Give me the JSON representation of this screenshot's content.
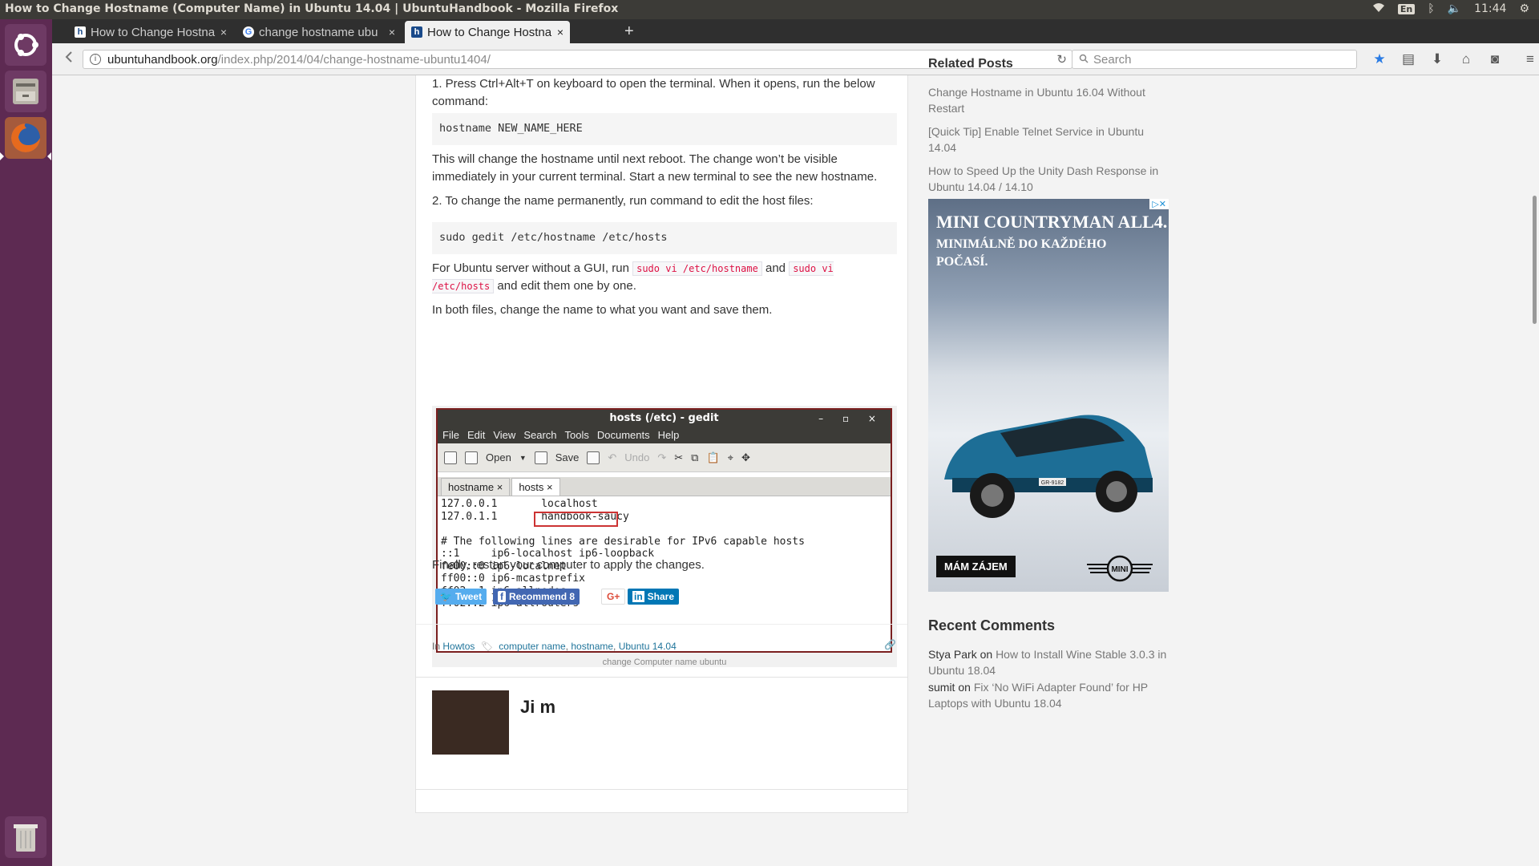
{
  "window": {
    "title": "How to Change Hostname (Computer Name) in Ubuntu 14.04 | UbuntuHandbook - Mozilla Firefox"
  },
  "panel": {
    "keyboard": "En",
    "clock": "11:44"
  },
  "tabs": [
    {
      "label": "How to Change Hostna",
      "favicon": "ubuntuhandbook-h"
    },
    {
      "label": "change hostname ubu",
      "favicon": "google-g"
    },
    {
      "label": "How to Change Hostna",
      "favicon": "ubuntuhandbook-h"
    }
  ],
  "navbar": {
    "url_host": "ubuntuhandbook.org",
    "url_path": "/index.php/2014/04/change-hostname-ubuntu1404/",
    "search_placeholder": "Search"
  },
  "article": {
    "p1": "1. Press Ctrl+Alt+T on keyboard to open the terminal. When it opens, run the below command:",
    "code1": "hostname NEW_NAME_HERE",
    "p2": "This will change the hostname until next reboot. The change won’t be visible immediately in your current terminal. Start a new terminal to see the new hostname.",
    "p3": "2. To change the name permanently, run command to edit the host files:",
    "code2": "sudo gedit /etc/hostname /etc/hosts",
    "p4_a": "For Ubuntu server without a GUI, run ",
    "p4_code1": "sudo vi /etc/hostname",
    "p4_b": " and ",
    "p4_code2": "sudo vi /etc/hosts",
    "p4_c": " and edit them one by one.",
    "p5": "In both files, change the name to what you want and save them.",
    "p6": "Finally, restart your computer to apply the changes."
  },
  "gedit": {
    "title": "hosts (/etc) - gedit",
    "menu": [
      "File",
      "Edit",
      "View",
      "Search",
      "Tools",
      "Documents",
      "Help"
    ],
    "toolbar": {
      "open": "Open",
      "save": "Save",
      "undo": "Undo"
    },
    "tabs": [
      "hostname",
      "hosts"
    ],
    "lines": [
      "127.0.0.1       localhost",
      "127.0.1.1       handbook-saucy",
      "",
      "# The following lines are desirable for IPv6 capable hosts",
      "::1     ip6-localhost ip6-loopback",
      "fe00::0 ip6-localnet",
      "ff00::0 ip6-mcastprefix",
      "ff02::1 ip6-allnodes",
      "ff02::2 ip6-allrouters"
    ],
    "caption": "change Computer name ubuntu"
  },
  "share": {
    "tweet": "Tweet",
    "recommend": "Recommend 8",
    "gplus": "G+",
    "linkedin": "Share"
  },
  "meta": {
    "in_label": "In",
    "category": "Howtos",
    "tags": [
      "computer name",
      "hostname",
      "Ubuntu 14.04"
    ]
  },
  "author": {
    "name": "Ji m"
  },
  "sidebar": {
    "related_title": "Related Posts",
    "related": [
      "Change Hostname in Ubuntu 16.04 Without Restart",
      "[Quick Tip] Enable Telnet Service in Ubuntu 14.04",
      "How to Speed Up the Unity Dash Response in Ubuntu 14.04 / 14.10"
    ],
    "ad": {
      "title": "MINI COUNTRYMAN ALL4.",
      "subtitle": "MINIMÁLNĚ DO KAŽDÉHO POČASÍ.",
      "button": "MÁM ZÁJEM",
      "logo": "MINI",
      "plate": "GR-9182"
    },
    "recent_title": "Recent Comments",
    "comments": [
      {
        "author": "Stya Park",
        "on": " on ",
        "post": "How to Install Wine Stable 3.0.3 in Ubuntu 18.04"
      },
      {
        "author": "sumit",
        "on": " on ",
        "post": "Fix ‘No WiFi Adapter Found’ for HP Laptops with Ubuntu 18.04"
      }
    ]
  },
  "colors": {
    "launcher": "#5d2a52",
    "panel": "#3c3b37",
    "link": "#21759b",
    "inline_code": "#d14"
  }
}
